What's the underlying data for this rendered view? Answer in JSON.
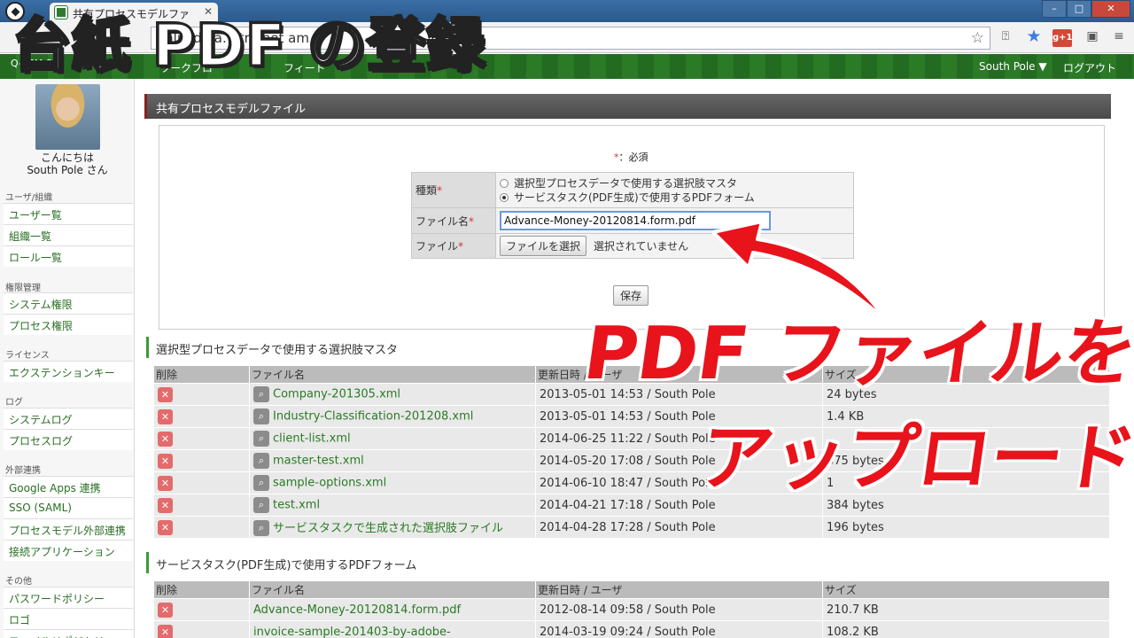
{
  "browser": {
    "tab_title": "共有プロセスモデルファ",
    "tab_close": "✕",
    "url": "onlin  de   a.  etra.net   am",
    "gplus": "g+1"
  },
  "appbar": {
    "logo": "Q-BPM SI",
    "nav_1": "ワークフロー",
    "nav_2": "フィード",
    "user_menu": "South Pole ▼",
    "logout": "ログアウト"
  },
  "sidebar": {
    "greet_line1": "こんにちは",
    "greet_line2": "South Pole さん",
    "sections": [
      {
        "title": "ユーザ/組織",
        "items": [
          "ユーザー覧",
          "組織一覧",
          "ロール一覧"
        ]
      },
      {
        "title": "権限管理",
        "items": [
          "システム権限",
          "プロセス権限"
        ]
      },
      {
        "title": "ライセンス",
        "items": [
          "エクステンションキー"
        ]
      },
      {
        "title": "ログ",
        "items": [
          "システムログ",
          "プロセスログ"
        ]
      },
      {
        "title": "外部連携",
        "items": [
          "Google Apps 連携",
          "SSO (SAML)",
          "プロセスモデル外部連携",
          "接続アプリケーション"
        ]
      },
      {
        "title": "その他",
        "items": [
          "パスワードポリシー",
          "ロゴ",
          "ファイルリポジトリ"
        ]
      }
    ]
  },
  "page": {
    "header": "共有プロセスモデルファイル",
    "required_mark": "*",
    "required_note": "：必須",
    "form": {
      "type_label": "種類",
      "type_option_1": "選択型プロセスデータで使用する選択肢マスタ",
      "type_option_2": "サービスタスク(PDF生成)で使用するPDFフォーム",
      "filename_label": "ファイル名",
      "filename_value": "Advance-Money-20120814.form.pdf",
      "file_label": "ファイル",
      "file_button": "ファイルを選択",
      "no_file": "選択されていません",
      "save": "保存"
    }
  },
  "table1": {
    "title": "選択型プロセスデータで使用する選択肢マスタ",
    "headers": [
      "削除",
      "ファイル名",
      "更新日時 / ユーザ",
      "サイズ"
    ],
    "rows": [
      {
        "name": "Company-201305.xml",
        "date": "2013-05-01 14:53 / South Pole",
        "size": "24 bytes"
      },
      {
        "name": "Industry-Classification-201208.xml",
        "date": "2013-05-01 14:53 / South Pole",
        "size": "1.4 KB"
      },
      {
        "name": "client-list.xml",
        "date": "2014-06-25 11:22 / South Pole",
        "size": ""
      },
      {
        "name": "master-test.xml",
        "date": "2014-05-20 17:08 / South Pole",
        "size": "875 bytes"
      },
      {
        "name": "sample-options.xml",
        "date": "2014-06-10 18:47 / South Pole",
        "size": "1"
      },
      {
        "name": "test.xml",
        "date": "2014-04-21 17:18 / South Pole",
        "size": "384 bytes"
      },
      {
        "name": "サービスタスクで生成された選択肢ファイル",
        "date": "2014-04-28 17:28 / South Pole",
        "size": "196 bytes"
      }
    ]
  },
  "table2": {
    "title": "サービスタスク(PDF生成)で使用するPDFフォーム",
    "headers": [
      "削除",
      "ファイル名",
      "更新日時 / ユーザ",
      "サイズ"
    ],
    "rows": [
      {
        "name": "Advance-Money-20120814.form.pdf",
        "date": "2012-08-14 09:58 / South Pole",
        "size": "210.7 KB"
      },
      {
        "name": "invoice-sample-201403-by-adobe-",
        "date": "2014-03-19 09:24 / South Pole",
        "size": "108.2 KB"
      }
    ]
  },
  "overlay": {
    "title": "台紙 PDF の登録",
    "caption_line1": "PDF ファイルを",
    "caption_line2": "アップロード"
  },
  "colors": {
    "header_green": "#2a7a26",
    "link_green": "#2a7a24",
    "overlay_red": "#e8131b"
  }
}
